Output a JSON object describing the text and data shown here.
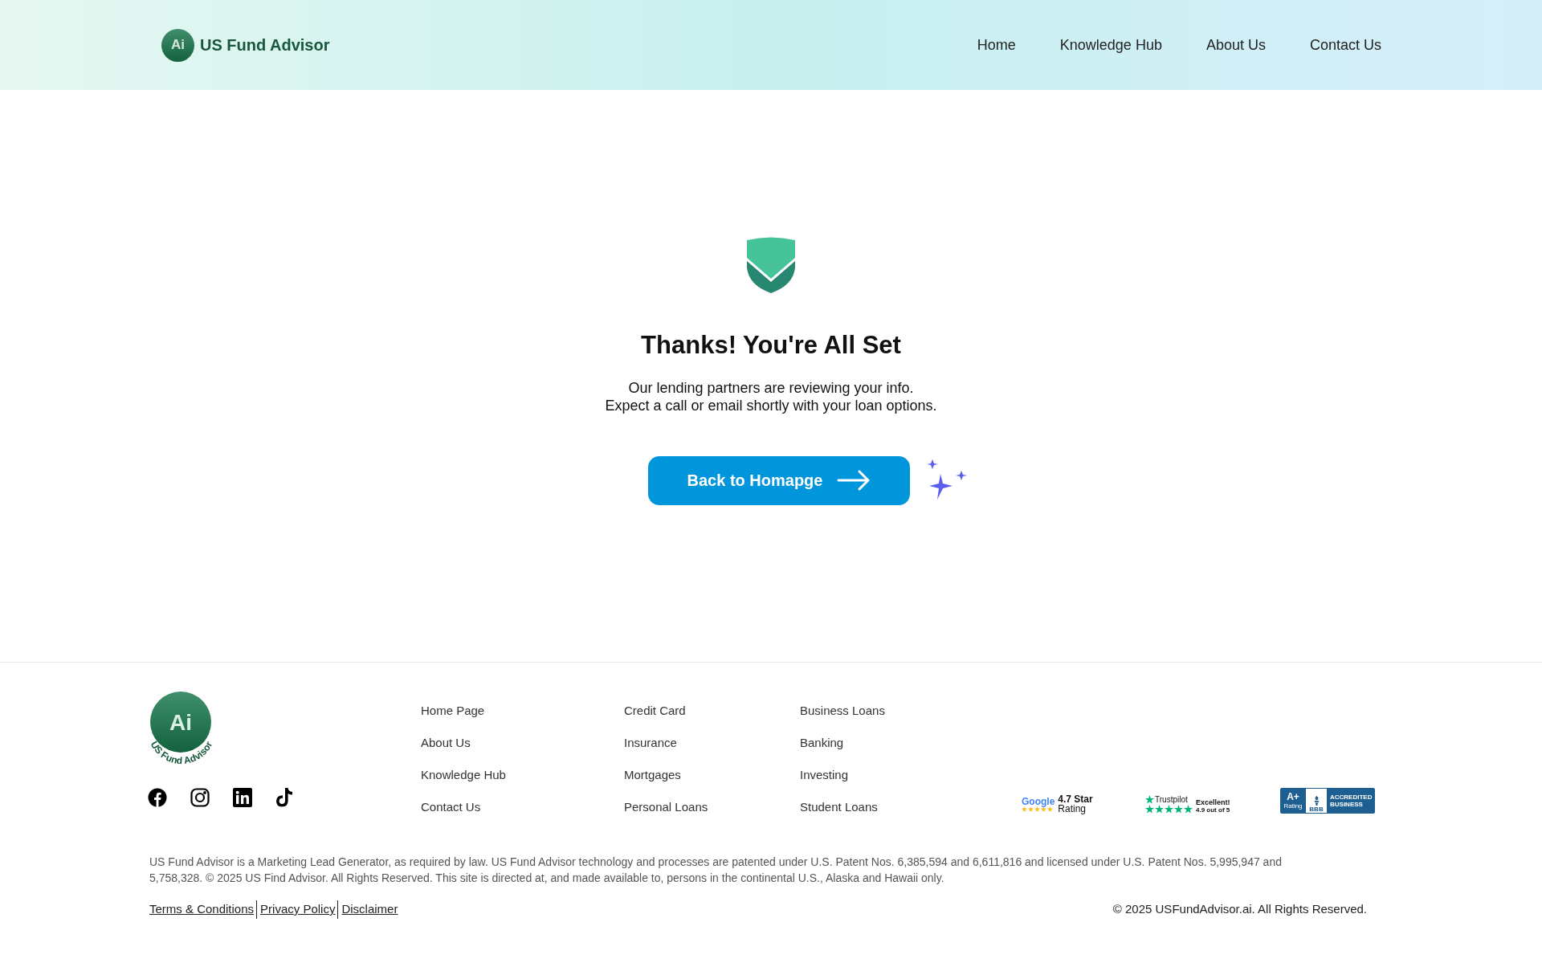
{
  "header": {
    "logo_mark": "Ai",
    "brand": "US Fund Advisor",
    "nav": [
      {
        "label": "Home"
      },
      {
        "label": "Knowledge Hub"
      },
      {
        "label": "About Us"
      },
      {
        "label": "Contact Us"
      }
    ]
  },
  "main": {
    "title": "Thanks! You're All Set",
    "lines": [
      "Our lending partners are reviewing your info.",
      "Expect a call or email shortly with your loan options."
    ],
    "button": "Back to Homapge"
  },
  "footer": {
    "logo_mark": "Ai",
    "logo_text": "US Fund Advisor",
    "columns": [
      [
        "Home Page",
        "About Us",
        "Knowledge Hub",
        "Contact Us"
      ],
      [
        "Credit Card",
        "Insurance",
        "Mortgages",
        "Personal Loans"
      ],
      [
        "Business Loans",
        "Banking",
        "Investing",
        "Student Loans"
      ]
    ],
    "social": [
      {
        "kind": "facebook"
      },
      {
        "kind": "instagram"
      },
      {
        "kind": "linkedin"
      },
      {
        "kind": "tiktok"
      }
    ],
    "badges": {
      "google": {
        "brand": "Google",
        "stars": 5,
        "line1": "4.7 Star",
        "line2": "Rating"
      },
      "trustpilot": {
        "brand": "Trustpilot",
        "stars": 5,
        "line1": "Excellent!",
        "line2": "4.9 out of 5"
      },
      "bbb": {
        "grade": "A+",
        "grade_label": "Rating",
        "brand": "BBB",
        "line1": "ACCREDITED",
        "line2": "BUSINESS"
      }
    },
    "disclaimer": "US Fund Advisor is a Marketing Lead Generator, as required by law. US Fund Advisor technology and processes are patented under U.S. Patent Nos. 6,385,594 and 6,611,816 and licensed under U.S. Patent Nos. 5,995,947 and 5,758,328. © 2025 US Find Advisor. All Rights Reserved. This site is directed at, and made available to, persons in the continental U.S., Alaska and Hawaii only.",
    "legal_links": [
      "Terms & Conditions",
      "Privacy Policy",
      "Disclaimer"
    ],
    "copyright": "© 2025 USFundAdvisor.ai. All Rights Reserved."
  }
}
